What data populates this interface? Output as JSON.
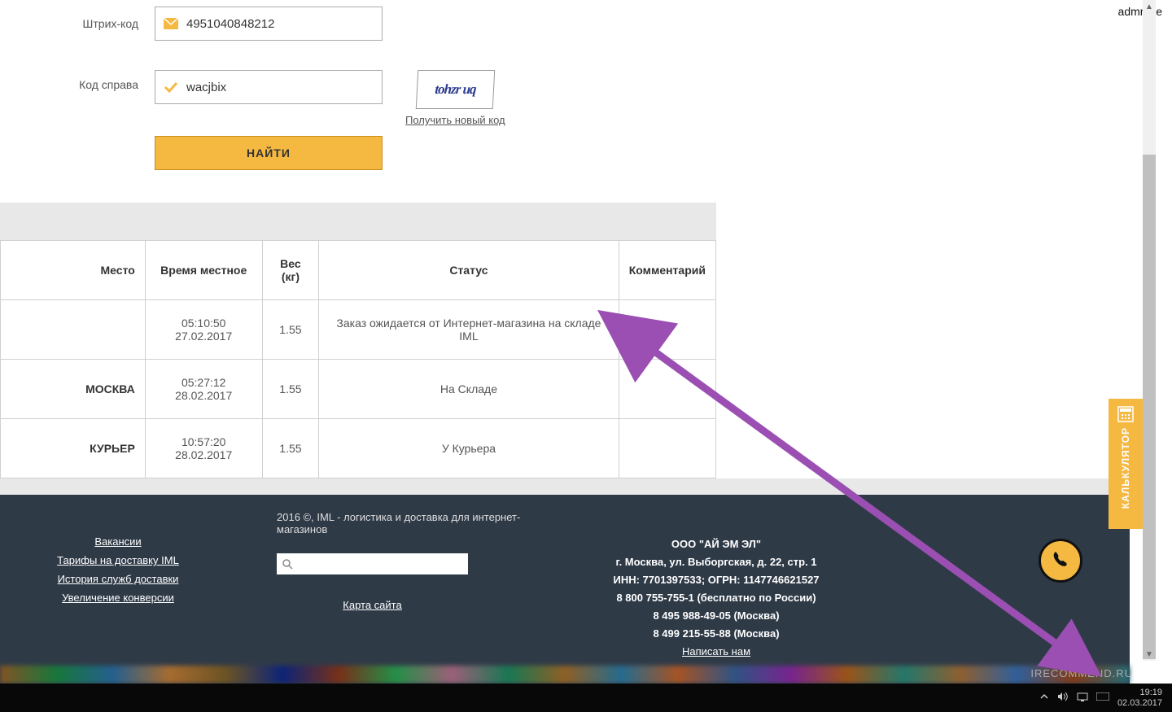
{
  "form": {
    "barcode_label": "Штрих-код",
    "barcode_value": "4951040848212",
    "captcha_label": "Код справа",
    "captcha_value": "wacjbix",
    "captcha_image_text": "tohzr uq",
    "captcha_new_link": "Получить новый код",
    "find_button": "НАЙТИ"
  },
  "table": {
    "headers": {
      "place": "Место",
      "time": "Время местное",
      "weight": "Вес (кг)",
      "status": "Статус",
      "comment": "Комментарий"
    },
    "rows": [
      {
        "place": "",
        "time": "05:10:50 27.02.2017",
        "weight": "1.55",
        "status": "Заказ ожидается от Интернет-магазина на складе IML",
        "comment": ""
      },
      {
        "place": "МОСКВА",
        "time": "05:27:12 28.02.2017",
        "weight": "1.55",
        "status": "На Складе",
        "comment": ""
      },
      {
        "place": "КУРЬЕР",
        "time": "10:57:20 28.02.2017",
        "weight": "1.55",
        "status": "У Курьера",
        "comment": ""
      }
    ]
  },
  "footer": {
    "copyright": "2016 ©, IML - логистика и доставка для интернет-магазинов",
    "links": [
      "Вакансии",
      "Тарифы на доставку IML",
      "История служб доставки",
      "Увеличение конверсии"
    ],
    "sitemap": "Карта сайта",
    "company_name": "ООО \"АЙ ЭМ ЭЛ\"",
    "address": "г. Москва, ул. Выборгская, д. 22, стр. 1",
    "inn": "ИНН: 7701397533; ОГРН: 1147746621527",
    "phone_free": "8 800 755-755-1 (бесплатно по России)",
    "phone_msk1": "8 495 988-49-05 (Москва)",
    "phone_msk2": "8 499 215-55-88 (Москва)",
    "write_us": "Написать нам"
  },
  "side": {
    "calc": "КАЛЬКУЛЯТОР"
  },
  "top_label": "admrave",
  "taskbar": {
    "time": "19:19",
    "date": "02.03.2017"
  },
  "watermark": "IRECOMMEND.RU"
}
